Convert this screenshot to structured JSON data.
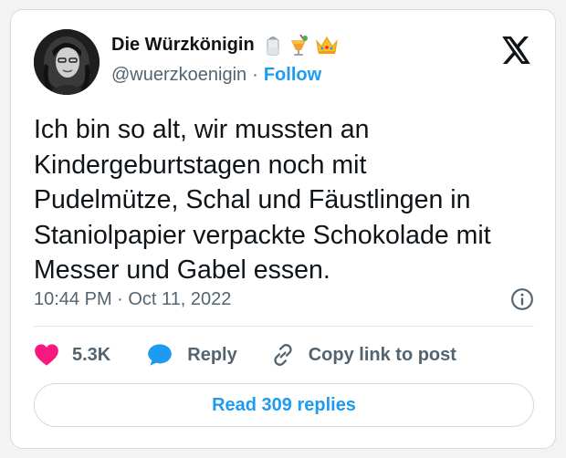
{
  "author": {
    "display_name": "Die Würzkönigin",
    "handle": "@wuerzkoenigin",
    "separator": "·",
    "follow_label": "Follow",
    "emojis": [
      "salt-shaker-icon",
      "tropical-drink-icon",
      "crown-icon"
    ]
  },
  "tweet": {
    "text_lines": [
      "Ich bin so alt, wir mussten an",
      "Kindergeburtstagen noch mit",
      "Pudelmütze, Schal und Fäustlingen in",
      "Staniolpapier verpackte Schokolade mit",
      "Messer und Gabel essen."
    ],
    "timestamp": "10:44 PM · Oct 11, 2022"
  },
  "actions": {
    "like_count": "5.3K",
    "reply_label": "Reply",
    "copy_label": "Copy link to post"
  },
  "footer": {
    "read_replies_label": "Read 309 replies"
  },
  "colors": {
    "accent": "#1d9bf0",
    "like": "#f91880",
    "text": "#0f1419",
    "secondary": "#536471"
  }
}
